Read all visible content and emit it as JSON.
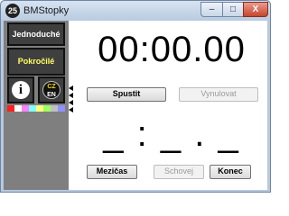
{
  "window": {
    "title": "BMStopky",
    "app_icon_text": "25",
    "controls": {
      "minimize": "–",
      "maximize": "□",
      "close": "X"
    }
  },
  "sidebar": {
    "mode_simple": "Jednoduché",
    "mode_advanced": "Pokročilé",
    "info_icon": "i",
    "lang_cz": "CZ",
    "lang_en": "EN",
    "swatch_colors": [
      "#ff2020",
      "#ffffff",
      "#ff80ff",
      "#80ffff",
      "#ffff80",
      "#a0ff60",
      "#c0c0c0",
      "#9090ff"
    ]
  },
  "main": {
    "time": "00:00.00",
    "start_label": "Spustit",
    "reset_label": "Vynulovat",
    "lap_time": "_:_._",
    "lap_label": "Mezičas",
    "hide_label": "Schovej",
    "end_label": "Konec"
  },
  "colors": {
    "panel_bg": "#7f7f7f",
    "button_bg": "#3f3f3f",
    "advanced_text": "#ffff66"
  }
}
